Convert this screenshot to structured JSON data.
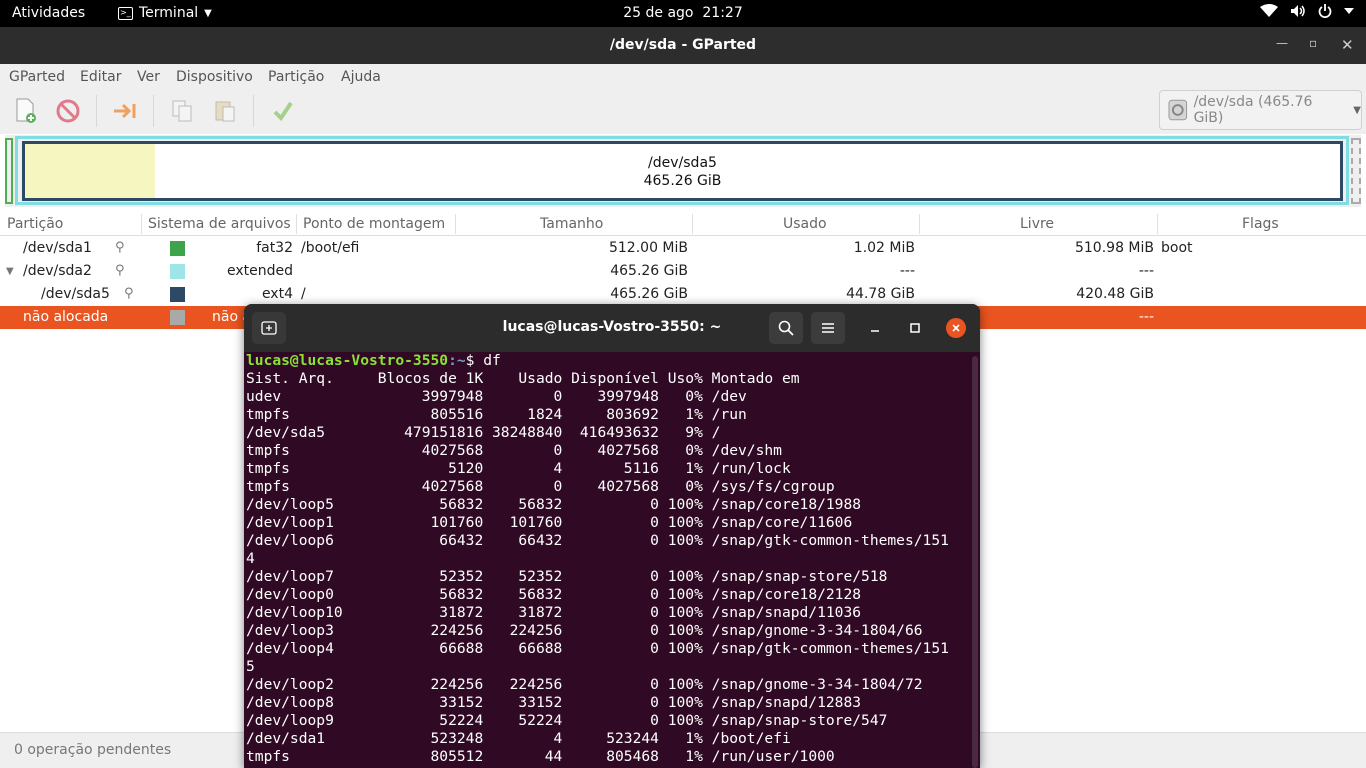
{
  "topbar": {
    "activities": "Atividades",
    "app_name": "Terminal",
    "date": "25 de ago",
    "time": "21:27",
    "icons": [
      "wifi-icon",
      "volume-icon",
      "power-icon",
      "chevron-down-icon"
    ]
  },
  "gparted": {
    "title": "/dev/sda - GParted",
    "menu": [
      "GParted",
      "Editar",
      "Ver",
      "Dispositivo",
      "Partição",
      "Ajuda"
    ],
    "toolbar_icons": [
      "new-partition-icon",
      "delete-icon",
      "resize-move-icon",
      "copy-icon",
      "paste-icon",
      "apply-icon"
    ],
    "device_selector": "/dev/sda (465.76 GiB)",
    "diskmap": {
      "name": "/dev/sda5",
      "size": "465.26 GiB"
    },
    "columns": [
      "Partição",
      "Sistema de arquivos",
      "Ponto de montagem",
      "Tamanho",
      "Usado",
      "Livre",
      "Flags"
    ],
    "rows": [
      {
        "partition": "/dev/sda1",
        "color": "#3fa34d",
        "fs": "fat32",
        "mount": "/boot/efi",
        "size": "512.00 MiB",
        "used": "1.02 MiB",
        "free": "510.98 MiB",
        "flags": "boot"
      },
      {
        "partition": "/dev/sda2",
        "color": "#9ee5e8",
        "fs": "extended",
        "mount": "",
        "size": "465.26 GiB",
        "used": "---",
        "free": "---",
        "flags": ""
      },
      {
        "partition": "/dev/sda5",
        "color": "#2e4964",
        "fs": "ext4",
        "mount": "/",
        "size": "465.26 GiB",
        "used": "44.78 GiB",
        "free": "420.48 GiB",
        "flags": ""
      },
      {
        "partition": "não alocada",
        "color": "#a9a9a9",
        "fs": "não a",
        "mount": "",
        "size": "",
        "used": "",
        "free": "---",
        "flags": ""
      }
    ],
    "status": "0 operação pendentes"
  },
  "terminal": {
    "title": "lucas@lucas-Vostro-3550: ~",
    "prompt_user": "lucas@lucas-Vostro-3550",
    "prompt_path": ":~",
    "prompt_cmd": "$ df",
    "output": [
      "Sist. Arq.     Blocos de 1K    Usado Disponível Uso% Montado em",
      "udev                3997948        0    3997948   0% /dev",
      "tmpfs                805516     1824     803692   1% /run",
      "/dev/sda5         479151816 38248840  416493632   9% /",
      "tmpfs               4027568        0    4027568   0% /dev/shm",
      "tmpfs                  5120        4       5116   1% /run/lock",
      "tmpfs               4027568        0    4027568   0% /sys/fs/cgroup",
      "/dev/loop5            56832    56832          0 100% /snap/core18/1988",
      "/dev/loop1           101760   101760          0 100% /snap/core/11606",
      "/dev/loop6            66432    66432          0 100% /snap/gtk-common-themes/151",
      "4",
      "/dev/loop7            52352    52352          0 100% /snap/snap-store/518",
      "/dev/loop0            56832    56832          0 100% /snap/core18/2128",
      "/dev/loop10           31872    31872          0 100% /snap/snapd/11036",
      "/dev/loop3           224256   224256          0 100% /snap/gnome-3-34-1804/66",
      "/dev/loop4            66688    66688          0 100% /snap/gtk-common-themes/151",
      "5",
      "/dev/loop2           224256   224256          0 100% /snap/gnome-3-34-1804/72",
      "/dev/loop8            33152    33152          0 100% /snap/snapd/12883",
      "/dev/loop9            52224    52224          0 100% /snap/snap-store/547",
      "/dev/sda1            523248        4     523244   1% /boot/efi",
      "tmpfs                805512       44     805468   1% /run/user/1000"
    ]
  }
}
